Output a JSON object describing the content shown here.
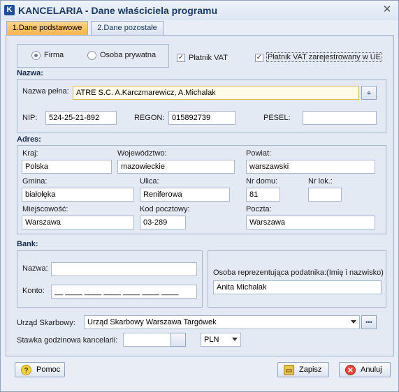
{
  "window": {
    "title": "KANCELARIA - Dane właściciela programu",
    "app_icon": "K"
  },
  "tabs": [
    {
      "label": "1.Dane podstawowe",
      "active": true
    },
    {
      "label": "2.Dane pozostałe",
      "active": false
    }
  ],
  "entity_type": {
    "firma_label": "Firma",
    "osoba_label": "Osoba prywatna",
    "selected": "Firma"
  },
  "vat": {
    "platnik_label": "Płatnik VAT",
    "platnik_checked": true,
    "ue_label": "Płatnik VAT zarejestrowany w UE",
    "ue_checked": true
  },
  "nazwa": {
    "section_label": "Nazwa:",
    "full_label": "Nazwa pełna:",
    "full_value": "ATRE S.C. A.Karczmarewicz, A.Michalak",
    "nip_label": "NIP:",
    "nip_value": "524-25-21-892",
    "regon_label": "REGON:",
    "regon_value": "015892739",
    "pesel_label": "PESEL:",
    "pesel_value": ""
  },
  "adres": {
    "section_label": "Adres:",
    "kraj_label": "Kraj:",
    "kraj_value": "Polska",
    "woj_label": "Województwo:",
    "woj_value": "mazowieckie",
    "powiat_label": "Powiat:",
    "powiat_value": "warszawski",
    "gmina_label": "Gmina:",
    "gmina_value": "białołęka",
    "ulica_label": "Ulica:",
    "ulica_value": "Reniferowa",
    "nrdomu_label": "Nr domu:",
    "nrdomu_value": "81",
    "nrlok_label": "Nr lok.:",
    "nrlok_value": "",
    "miejsc_label": "Miejscowość:",
    "miejsc_value": "Warszawa",
    "kod_label": "Kod pocztowy:",
    "kod_value": "03-289",
    "poczta_label": "Poczta:",
    "poczta_value": "Warszawa"
  },
  "bank": {
    "section_label": "Bank:",
    "nazwa_label": "Nazwa:",
    "nazwa_value": "",
    "konto_label": "Konto:",
    "konto_value": "__ ____ ____ ____ ____ ____ ____",
    "osoba_label": "Osoba reprezentująca podatnika:(Imię i nazwisko)",
    "osoba_value": "Anita Michalak"
  },
  "urzad": {
    "label": "Urząd Skarbowy:",
    "value": "Urząd Skarbowy Warszawa Targówek",
    "more_button": "•••"
  },
  "stawka": {
    "label": "Stawka godzinowa kancelarii:",
    "value": "",
    "currency": "PLN"
  },
  "buttons": {
    "pomoc": "Pomoc",
    "zapisz": "Zapisz",
    "anuluj": "Anuluj"
  }
}
